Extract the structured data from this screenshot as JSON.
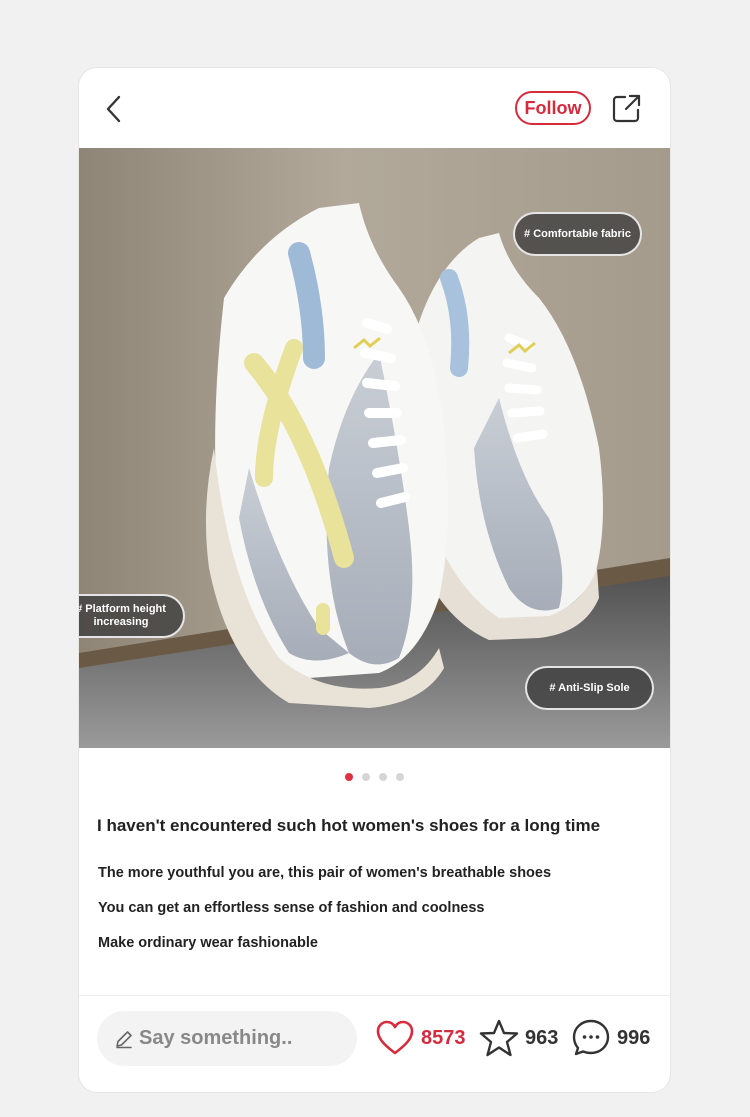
{
  "header": {
    "follow_label": "Follow",
    "icons": {
      "back": "back-chevron-icon",
      "share": "share-icon"
    }
  },
  "photo": {
    "tags": [
      "# Comfortable fabric",
      "# Platform height increasing",
      "# Anti-Slip Sole"
    ],
    "carousel": {
      "total": 4,
      "active": 1
    }
  },
  "post": {
    "title": "I haven't encountered such hot women's shoes for a long time",
    "lines": [
      "The more youthful you are, this pair of women's breathable shoes",
      "You can get an effortless sense of fashion and coolness",
      "Make ordinary wear fashionable"
    ]
  },
  "footer": {
    "comment_placeholder": "Say something..",
    "likes": "8573",
    "favorites": "963",
    "comments": "996",
    "icons": {
      "pencil": "pencil-icon",
      "heart": "heart-icon",
      "star": "star-icon",
      "comment": "comment-bubble-icon"
    }
  },
  "colors": {
    "accent": "#d62b3d",
    "active_dot": "#e0313f",
    "shoe_accent": "#e8e29a"
  }
}
